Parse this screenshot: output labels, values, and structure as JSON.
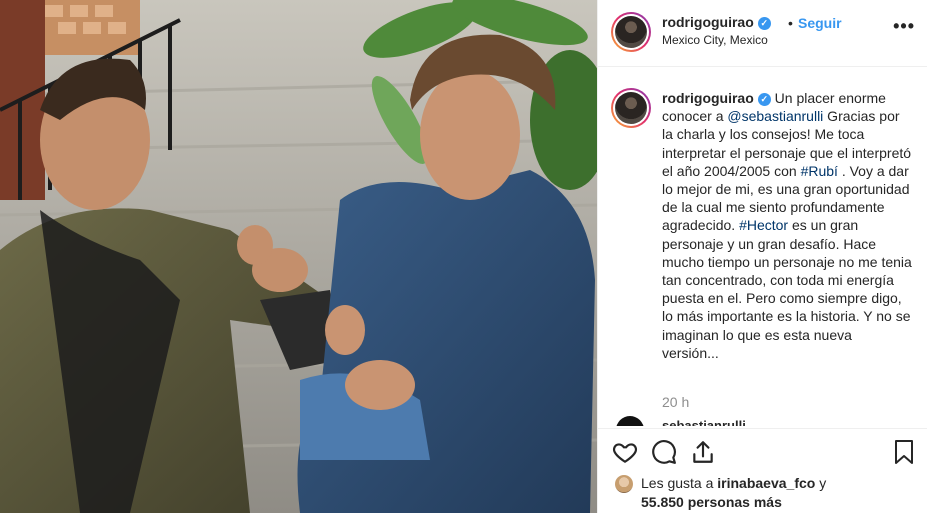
{
  "header": {
    "username": "rodrigoguirao",
    "separator": "•",
    "follow_label": "Seguir",
    "location": "Mexico City, Mexico",
    "more_label": "•••"
  },
  "caption": {
    "username": "rodrigoguirao",
    "text_1": "Un placer enorme conocer a ",
    "mention": "@sebastianrulli",
    "text_2": " Gracias por la charla y los consejos! Me toca interpretar el personaje que el interpretó el año 2004/2005 con ",
    "hashtag_1": "#Rubí",
    "text_3": " . Voy a dar lo mejor de mi, es una gran oportunidad de la cual me siento profundamente agradecido. ",
    "hashtag_2": "#Hector",
    "text_4": " es un gran personaje y un gran desafío. Hace mucho tiempo un personaje no me tenia tan concentrado, con toda mi energía puesta en el. Pero como siempre digo, lo más importante es la historia. Y no se imaginan lo que es esta nueva versión..."
  },
  "timestamp": "20 h",
  "next_comment": {
    "username": "sebastianrulli"
  },
  "likes": {
    "prefix": "Les gusta a ",
    "user": "irinabaeva_fco",
    "suffix": " y",
    "count_text": "55.850 personas más"
  },
  "icons": {
    "like": "heart-icon",
    "comment": "comment-icon",
    "share": "share-icon",
    "save": "bookmark-icon",
    "verified": "verified-badge-icon"
  },
  "colors": {
    "link": "#3897f0",
    "mention": "#003569",
    "muted": "#8e8e8e",
    "text": "#262626"
  }
}
